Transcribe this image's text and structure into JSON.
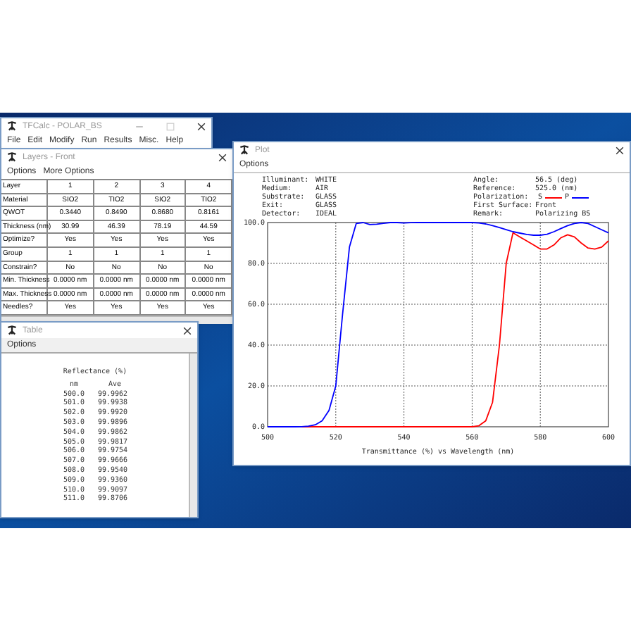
{
  "main_window": {
    "title": "TFCalc - POLAR_BS",
    "menu": [
      "File",
      "Edit",
      "Modify",
      "Run",
      "Results",
      "Misc.",
      "Help"
    ]
  },
  "layers_window": {
    "title": "Layers - Front",
    "menu": [
      "Options",
      "More Options"
    ],
    "rows": [
      [
        "Layer",
        "1",
        "2",
        "3",
        "4"
      ],
      [
        "Material",
        "SIO2",
        "TIO2",
        "SIO2",
        "TIO2"
      ],
      [
        "QWOT",
        "0.3440",
        "0.8490",
        "0.8680",
        "0.8161"
      ],
      [
        "Thickness (nm)",
        "30.99",
        "46.39",
        "78.19",
        "44.59"
      ],
      [
        "Optimize?",
        "Yes",
        "Yes",
        "Yes",
        "Yes"
      ],
      [
        "Group",
        "1",
        "1",
        "1",
        "1"
      ],
      [
        "Constrain?",
        "No",
        "No",
        "No",
        "No"
      ],
      [
        "Min. Thickness",
        "0.0000 nm",
        "0.0000 nm",
        "0.0000 nm",
        "0.0000 nm"
      ],
      [
        "Max. Thickness",
        "0.0000 nm",
        "0.0000 nm",
        "0.0000 nm",
        "0.0000 nm"
      ],
      [
        "Needles?",
        "Yes",
        "Yes",
        "Yes",
        "Yes"
      ]
    ]
  },
  "table_window": {
    "title": "Table",
    "menu": [
      "Options"
    ],
    "heading": "Reflectance (%)",
    "columns": [
      "nm",
      "Ave"
    ],
    "rows": [
      [
        "500.0",
        "99.9962"
      ],
      [
        "501.0",
        "99.9938"
      ],
      [
        "502.0",
        "99.9920"
      ],
      [
        "503.0",
        "99.9896"
      ],
      [
        "504.0",
        "99.9862"
      ],
      [
        "505.0",
        "99.9817"
      ],
      [
        "506.0",
        "99.9754"
      ],
      [
        "507.0",
        "99.9666"
      ],
      [
        "508.0",
        "99.9540"
      ],
      [
        "509.0",
        "99.9360"
      ],
      [
        "510.0",
        "99.9097"
      ],
      [
        "511.0",
        "99.8706"
      ]
    ]
  },
  "plot_window": {
    "title": "Plot",
    "menu": [
      "Options"
    ],
    "info_left": [
      {
        "label": "Illuminant:",
        "value": "WHITE"
      },
      {
        "label": "Medium:",
        "value": "AIR"
      },
      {
        "label": "Substrate:",
        "value": "GLASS"
      },
      {
        "label": "Exit:",
        "value": "GLASS"
      },
      {
        "label": "Detector:",
        "value": "IDEAL"
      }
    ],
    "info_right": [
      {
        "label": "Angle:",
        "value": "56.5 (deg)"
      },
      {
        "label": "Reference:",
        "value": "525.0 (nm)"
      },
      {
        "label": "Polarization:"
      },
      {
        "label": "First Surface:",
        "value": "Front"
      },
      {
        "label": "Remark:",
        "value": "Polarizing BS"
      }
    ],
    "chart_data": {
      "type": "line",
      "xlabel": "Transmittance (%) vs Wavelength (nm)",
      "x": [
        500,
        502,
        504,
        506,
        508,
        510,
        512,
        514,
        516,
        518,
        520,
        522,
        524,
        526,
        528,
        530,
        532,
        534,
        536,
        538,
        540,
        542,
        544,
        546,
        548,
        550,
        552,
        554,
        556,
        558,
        560,
        562,
        564,
        566,
        568,
        570,
        572,
        574,
        576,
        578,
        580,
        582,
        584,
        586,
        588,
        590,
        592,
        594,
        596,
        598,
        600
      ],
      "series": [
        {
          "name": "S",
          "color": "#ff0000",
          "values": [
            null,
            null,
            null,
            null,
            null,
            0,
            0,
            0,
            0,
            0,
            0,
            0,
            0,
            0,
            0,
            0,
            0,
            0,
            0,
            0,
            0,
            0,
            0,
            0,
            0,
            0,
            0,
            0,
            0,
            0,
            0,
            0.5,
            3,
            12,
            40,
            80,
            95,
            93,
            91,
            89,
            87,
            87,
            89,
            92.5,
            94,
            93,
            90,
            87.5,
            87,
            88,
            91
          ]
        },
        {
          "name": "P",
          "color": "#0000ff",
          "values": [
            0,
            0,
            0,
            0,
            0,
            0.1,
            0.3,
            1,
            3,
            8,
            20,
            55,
            88,
            99.5,
            100,
            99,
            99.2,
            99.6,
            100,
            100,
            99.8,
            99.9,
            100,
            100,
            100,
            100,
            100,
            100,
            100,
            100,
            100,
            99.8,
            99.3,
            98.5,
            97.5,
            96.5,
            95.5,
            94.8,
            94.2,
            93.8,
            93.8,
            94.3,
            95.5,
            97,
            98.5,
            99.5,
            100,
            99.5,
            98,
            96.5,
            95
          ]
        }
      ],
      "grid": true,
      "xlim": [
        500,
        600
      ],
      "ylim": [
        0,
        100
      ],
      "xticks": [
        500,
        520,
        540,
        560,
        580,
        600
      ],
      "yticks": [
        {
          "value": 0,
          "label": "0.0"
        },
        {
          "value": 20,
          "label": "20.0"
        },
        {
          "value": 40,
          "label": "40.0"
        },
        {
          "value": 60,
          "label": "60.0"
        },
        {
          "value": 80,
          "label": "80.0"
        },
        {
          "value": 100,
          "label": "100.0"
        }
      ]
    }
  }
}
